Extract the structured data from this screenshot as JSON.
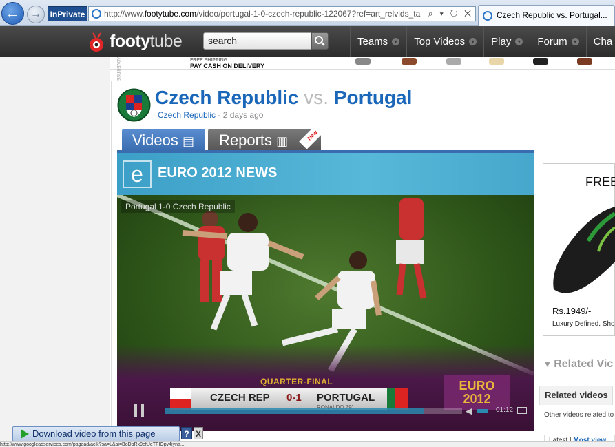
{
  "browser": {
    "back_label": "←",
    "forward_label": "→",
    "inprivate_label": "InPrivate",
    "url_prefix": "http://www.",
    "url_domain": "footytube.com",
    "url_rest": "/video/portugal-1-0-czech-republic-122067?ref=art_relvids_ta",
    "tab_title": "Czech Republic vs. Portugal...",
    "address_icons": "⌕ ▾ ↻ ✕"
  },
  "site": {
    "logo_bold": "footy",
    "logo_light": "tube",
    "search_placeholder": "search",
    "nav": [
      "Teams",
      "Top Videos",
      "Play",
      "Forum",
      "Cha"
    ]
  },
  "ad_strip": {
    "line1": "FREE SHIPPING",
    "line2": "PAY CASH ON DELIVERY",
    "label": "ADVERTISEMENT"
  },
  "match": {
    "home": "Czech Republic",
    "vs": "vs.",
    "away": "Portugal",
    "team_link": "Czech Republic",
    "time_ago": "- 2 days ago"
  },
  "tabs": {
    "videos": "Videos",
    "reports": "Reports",
    "new_badge": "New"
  },
  "video": {
    "banner": "EURO 2012 NEWS",
    "banner_logo": "e",
    "caption": "Portugal 1-0 Czech Republic",
    "stage": "QUARTER-FINAL",
    "home": "CZECH REP",
    "score": "0-1",
    "away": "PORTUGAL",
    "scorer": "RONALDO 79'",
    "tournament_line1": "EURO",
    "tournament_line2": "2012",
    "time": "01:12",
    "progress": 0.87
  },
  "sidebar": {
    "ad_headline": "FREE",
    "ad_price": "Rs.1949/-",
    "ad_tagline": "Luxury Defined. Sho",
    "related_heading": "Related Vic",
    "related_tab": "Related videos",
    "related_desc": "Other videos related to",
    "related_latest": "Latest",
    "related_most": "Most view"
  },
  "download": {
    "label": "Download video from this page",
    "help": "?",
    "close": "X"
  },
  "status": {
    "text": "http://www.googleadservices.com/pagead/aclk?sa=L&ai=BoDbRx9efUeTFIOpv4iyna..."
  },
  "colors": {
    "accent": "#1a66b8",
    "tab_active": "#3a6cb0",
    "banner": "#58b8d9"
  }
}
